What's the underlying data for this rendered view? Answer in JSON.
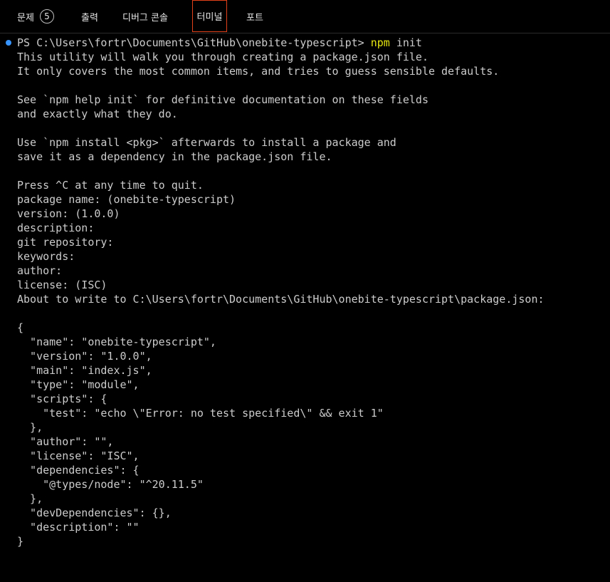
{
  "tabs": {
    "problems": "문제",
    "problems_count": "5",
    "output": "출력",
    "debug_console": "디버그 콘솔",
    "terminal": "터미널",
    "ports": "포트"
  },
  "colors": {
    "background": "#000000",
    "text": "#cccccc",
    "command": "#e5e510",
    "prompt_dot": "#3794ff",
    "active_tab_border": "#e2411a"
  },
  "terminal": {
    "prompt": "PS C:\\Users\\fortr\\Documents\\GitHub\\onebite-typescript> ",
    "command": "npm",
    "command_args": " init",
    "lines": [
      "This utility will walk you through creating a package.json file.",
      "It only covers the most common items, and tries to guess sensible defaults.",
      "",
      "See `npm help init` for definitive documentation on these fields",
      "and exactly what they do.",
      "",
      "Use `npm install <pkg>` afterwards to install a package and",
      "save it as a dependency in the package.json file.",
      "",
      "Press ^C at any time to quit.",
      "package name: (onebite-typescript)",
      "version: (1.0.0)",
      "description:",
      "git repository:",
      "keywords:",
      "author:",
      "license: (ISC)",
      "About to write to C:\\Users\\fortr\\Documents\\GitHub\\onebite-typescript\\package.json:",
      "",
      "{",
      "  \"name\": \"onebite-typescript\",",
      "  \"version\": \"1.0.0\",",
      "  \"main\": \"index.js\",",
      "  \"type\": \"module\",",
      "  \"scripts\": {",
      "    \"test\": \"echo \\\"Error: no test specified\\\" && exit 1\"",
      "  },",
      "  \"author\": \"\",",
      "  \"license\": \"ISC\",",
      "  \"dependencies\": {",
      "    \"@types/node\": \"^20.11.5\"",
      "  },",
      "  \"devDependencies\": {},",
      "  \"description\": \"\"",
      "}"
    ]
  }
}
